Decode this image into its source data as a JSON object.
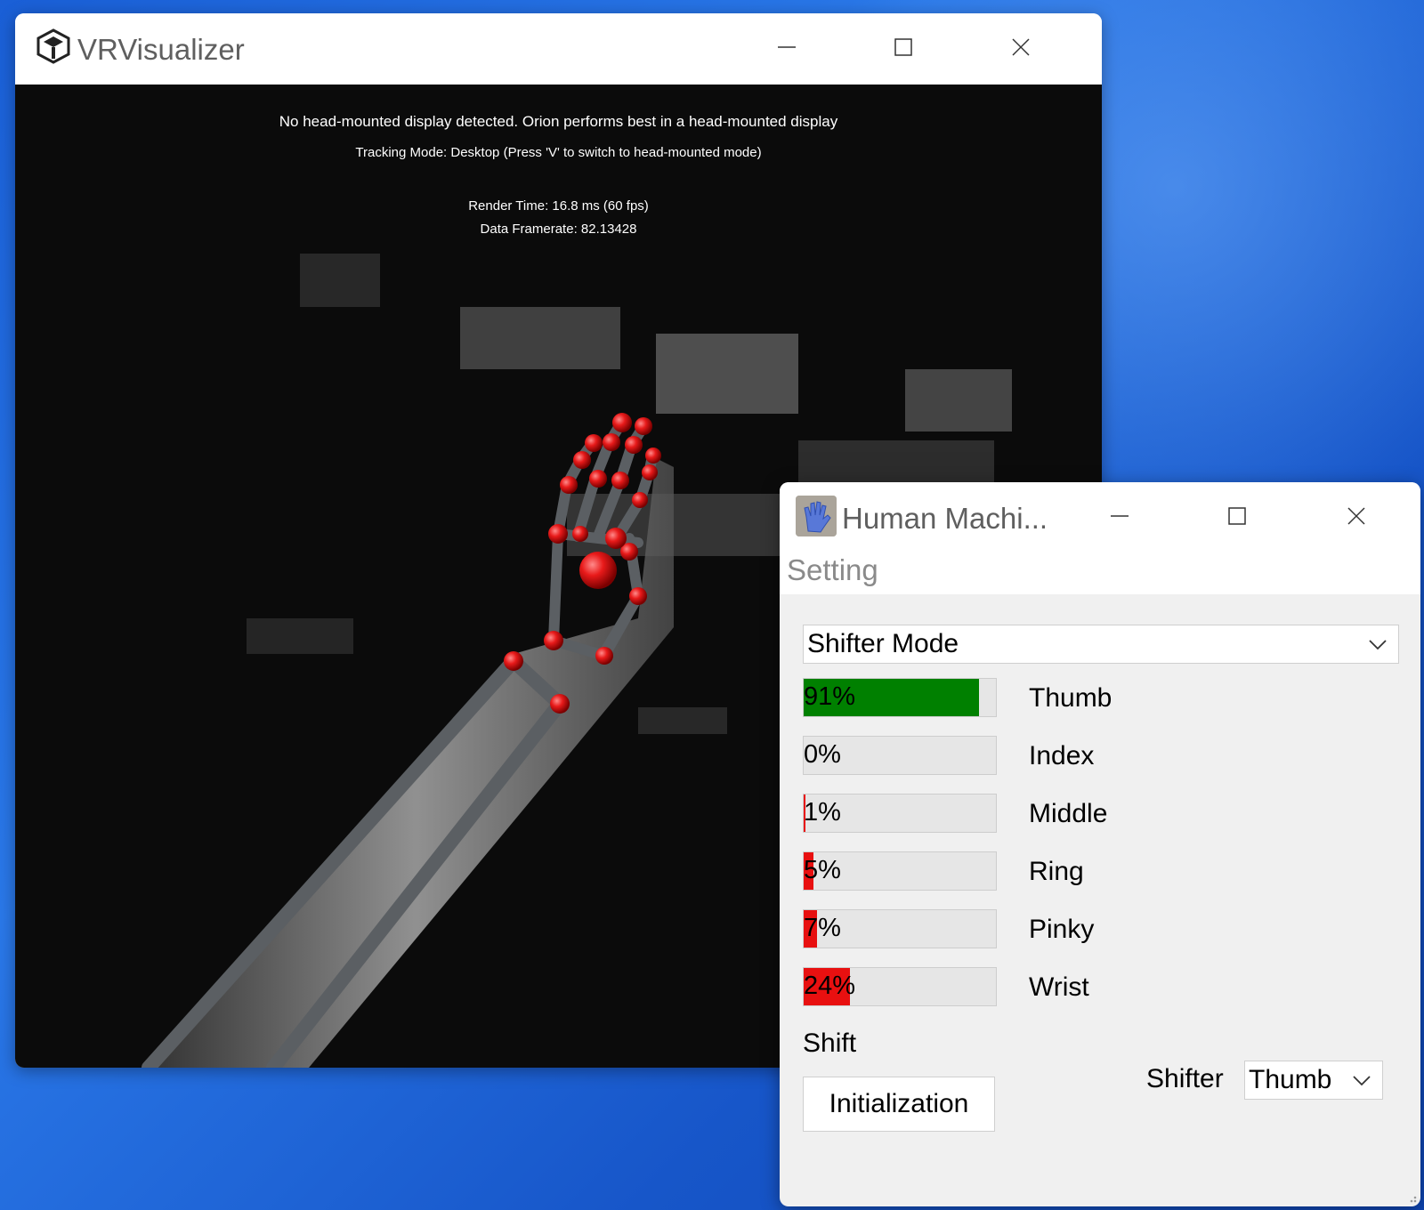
{
  "vr_window": {
    "title": "VRVisualizer",
    "icons": {
      "logo": "unity-logo-icon",
      "minimize": "minimize-icon",
      "maximize": "maximize-icon",
      "close": "close-icon"
    },
    "overlay": {
      "hmd_notice": "No head-mounted display detected. Orion performs best in a head-mounted display",
      "tracking_mode": "Tracking Mode: Desktop (Press 'V' to switch to head-mounted mode)",
      "render_time": "Render Time: 16.8 ms (60 fps)",
      "data_framerate": "Data Framerate: 82.13428"
    }
  },
  "hm_window": {
    "title": "Human Machi...",
    "icons": {
      "app": "hand-icon",
      "minimize": "minimize-icon",
      "maximize": "maximize-icon",
      "close": "close-icon"
    },
    "tab_label": "Setting",
    "mode_select": {
      "value": "Shifter Mode"
    },
    "fingers": [
      {
        "label": "Thumb",
        "percent_text": "91%",
        "percent": 91,
        "color": "#008000"
      },
      {
        "label": "Index",
        "percent_text": "0%",
        "percent": 0,
        "color": "#e81010"
      },
      {
        "label": "Middle",
        "percent_text": "1%",
        "percent": 1,
        "color": "#e81010"
      },
      {
        "label": "Ring",
        "percent_text": "5%",
        "percent": 5,
        "color": "#e81010"
      },
      {
        "label": "Pinky",
        "percent_text": "7%",
        "percent": 7,
        "color": "#e81010"
      },
      {
        "label": "Wrist",
        "percent_text": "24%",
        "percent": 24,
        "color": "#e81010"
      }
    ],
    "shift_label": "Shift",
    "init_button": "Initialization",
    "shifter_label": "Shifter",
    "shifter_select": {
      "value": "Thumb"
    }
  }
}
